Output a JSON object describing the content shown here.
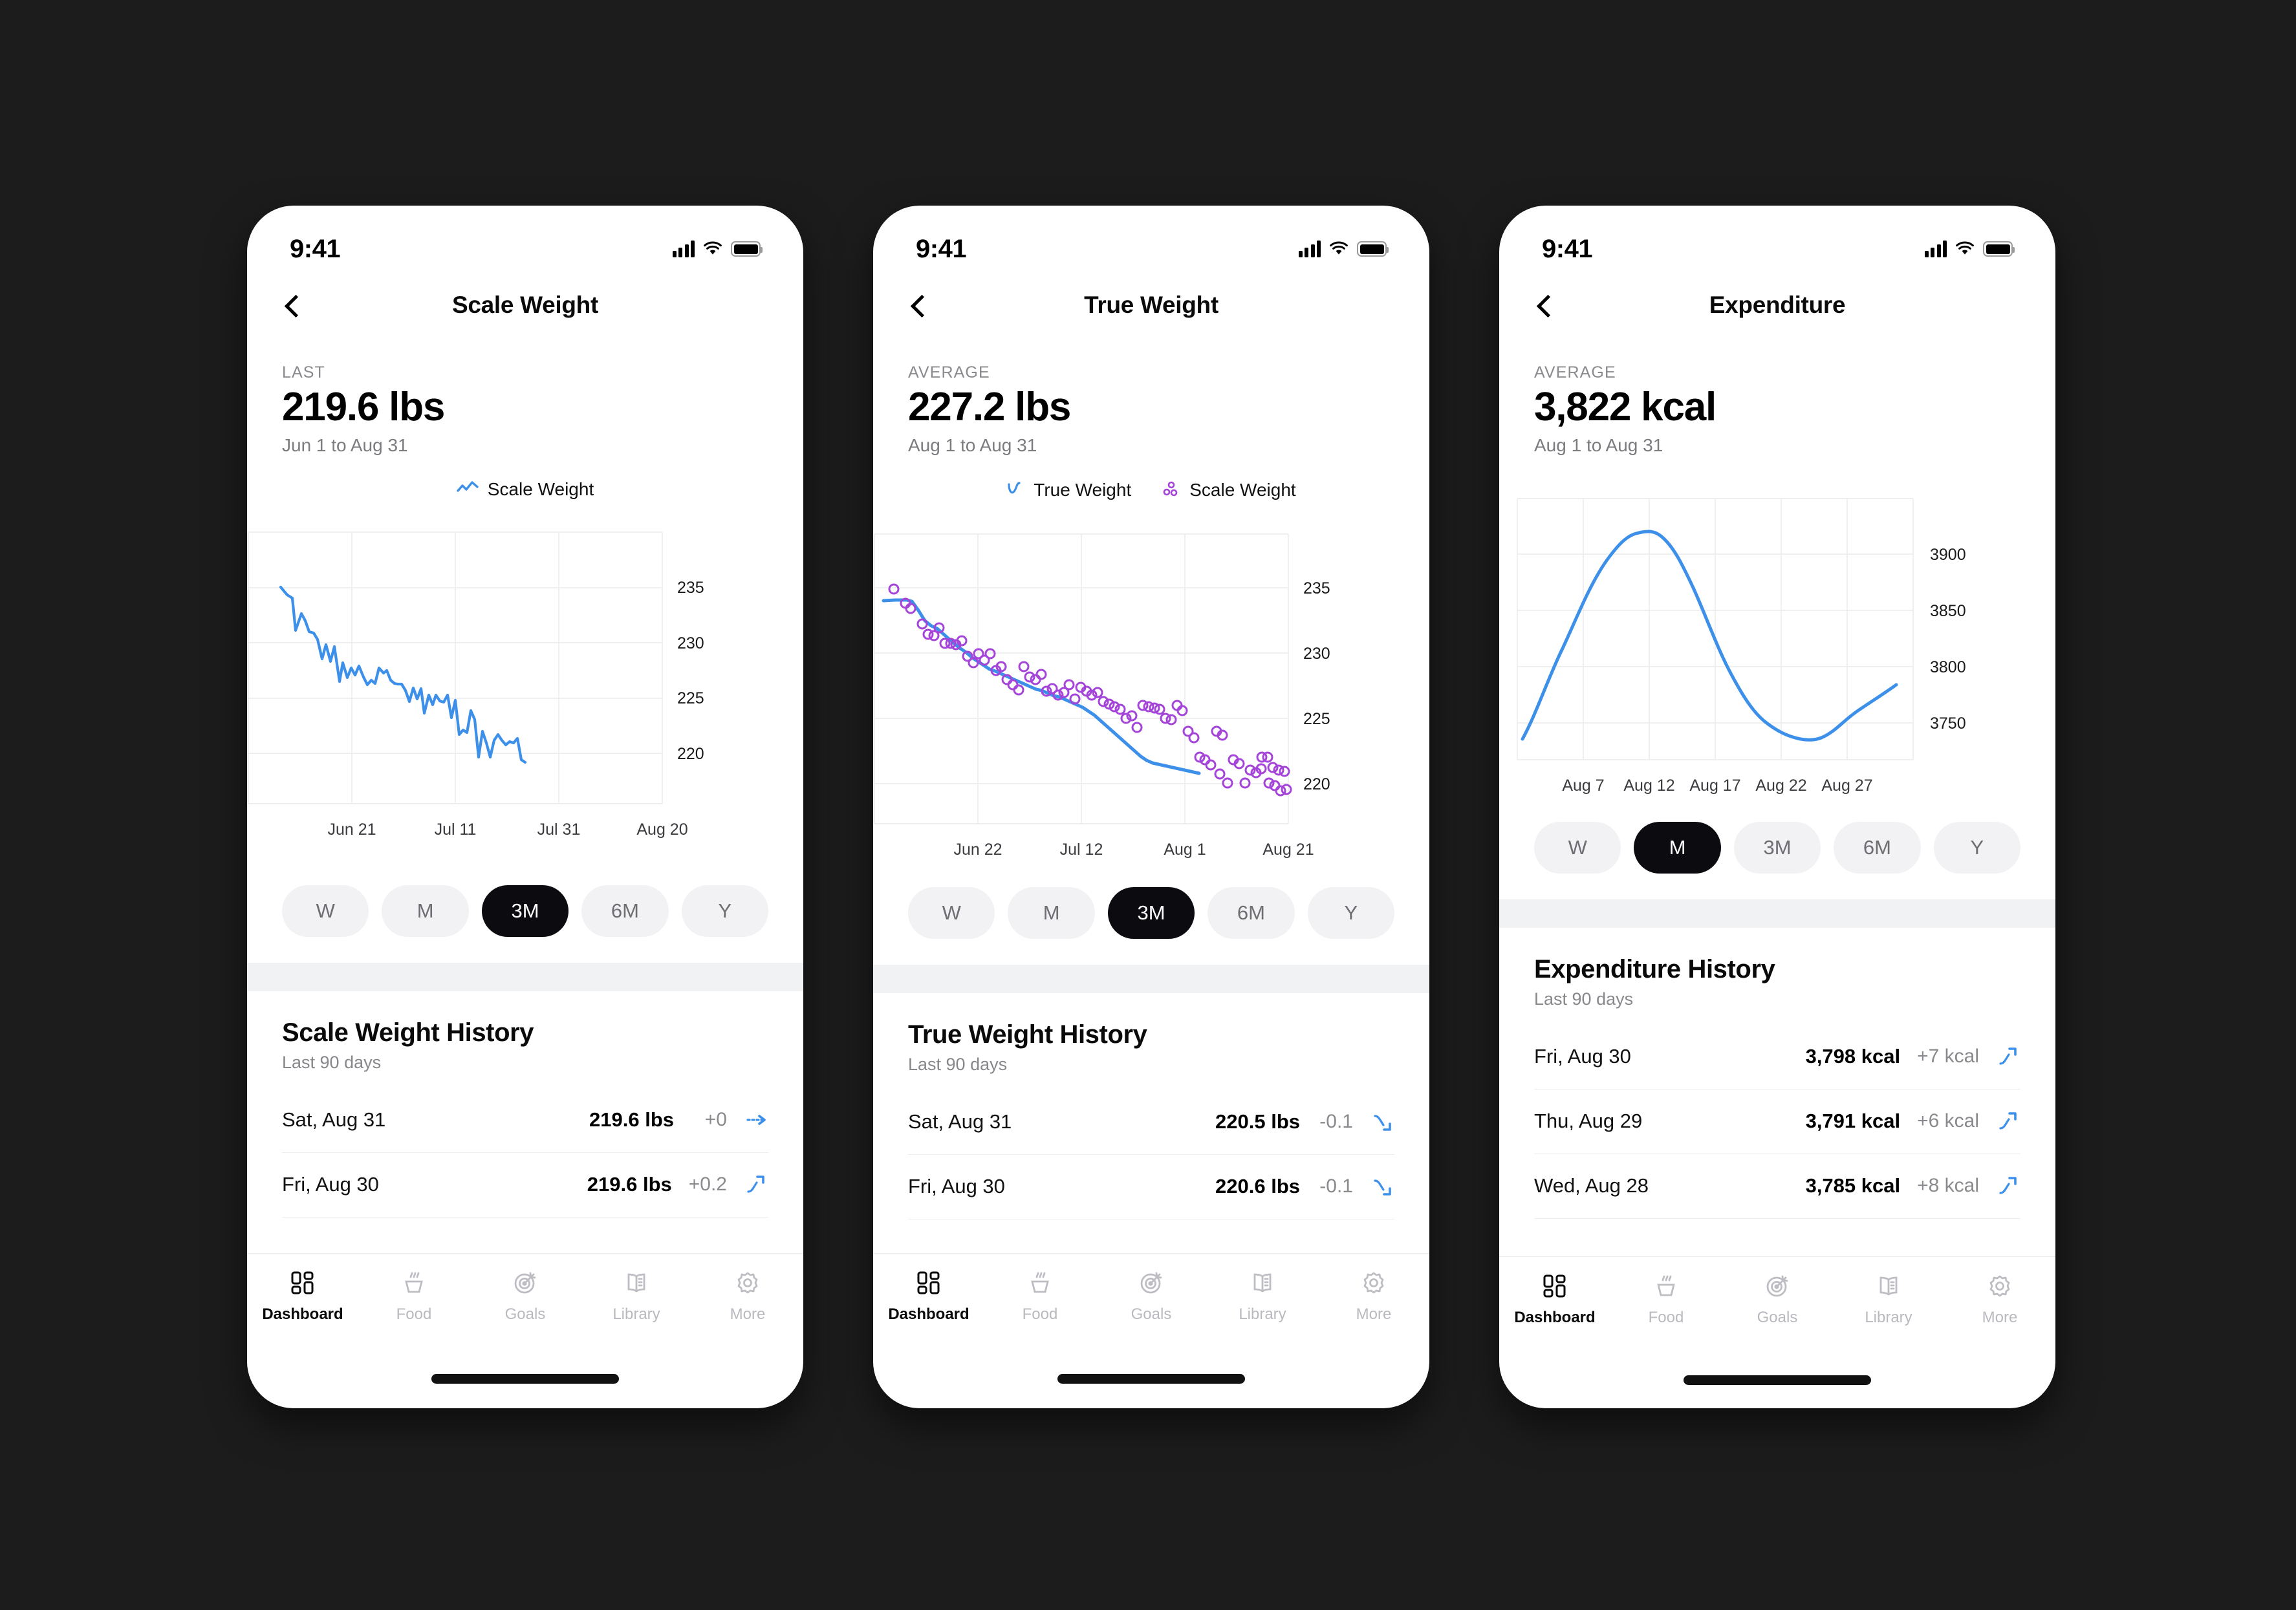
{
  "colors": {
    "accent_blue": "#3d90ea",
    "scatter_purple": "#a444d8",
    "active_pill": "#0b0b10",
    "pill_bg": "#f2f2f4",
    "canvas_bg": "#1c1c1c",
    "muted_text": "#8a8a8e"
  },
  "status_bar": {
    "time": "9:41"
  },
  "tabs": [
    {
      "label": "Dashboard",
      "icon": "dashboard-icon",
      "active": true
    },
    {
      "label": "Food",
      "icon": "food-cup-icon",
      "active": false
    },
    {
      "label": "Goals",
      "icon": "target-icon",
      "active": false
    },
    {
      "label": "Library",
      "icon": "book-icon",
      "active": false
    },
    {
      "label": "More",
      "icon": "gear-icon",
      "active": false
    }
  ],
  "range_options": [
    "W",
    "M",
    "3M",
    "6M",
    "Y"
  ],
  "screens": [
    {
      "id": "scale-weight",
      "nav_title": "Scale Weight",
      "summary_label": "LAST",
      "summary_value": "219.6 lbs",
      "summary_range": "Jun 1 to Aug 31",
      "legend": [
        {
          "label": "Scale Weight",
          "icon": "line-chart-icon",
          "color": "#3d90ea"
        }
      ],
      "selected_range": "3M",
      "history_title": "Scale Weight History",
      "history_sub": "Last 90 days",
      "history_rows": [
        {
          "date": "Sat, Aug 31",
          "value": "219.6 lbs",
          "delta": "+0",
          "trend": "flat"
        },
        {
          "date": "Fri, Aug 30",
          "value": "219.6 lbs",
          "delta": "+0.2",
          "trend": "up"
        }
      ]
    },
    {
      "id": "true-weight",
      "nav_title": "True Weight",
      "summary_label": "AVERAGE",
      "summary_value": "227.2 lbs",
      "summary_range": "Aug 1 to Aug 31",
      "legend": [
        {
          "label": "True Weight",
          "icon": "wave-line-icon",
          "color": "#3d90ea"
        },
        {
          "label": "Scale Weight",
          "icon": "scatter-dots-icon",
          "color": "#a444d8"
        }
      ],
      "selected_range": "3M",
      "history_title": "True Weight History",
      "history_sub": "Last 90 days",
      "history_rows": [
        {
          "date": "Sat, Aug 31",
          "value": "220.5 lbs",
          "delta": "-0.1",
          "trend": "down"
        },
        {
          "date": "Fri, Aug 30",
          "value": "220.6 lbs",
          "delta": "-0.1",
          "trend": "down"
        }
      ]
    },
    {
      "id": "expenditure",
      "nav_title": "Expenditure",
      "summary_label": "AVERAGE",
      "summary_value": "3,822 kcal",
      "summary_range": "Aug 1 to Aug 31",
      "legend": [],
      "selected_range": "M",
      "history_title": "Expenditure History",
      "history_sub": "Last 90 days",
      "history_rows": [
        {
          "date": "Fri, Aug 30",
          "value": "3,798 kcal",
          "delta": "+7 kcal",
          "trend": "up"
        },
        {
          "date": "Thu, Aug 29",
          "value": "3,791 kcal",
          "delta": "+6 kcal",
          "trend": "up"
        },
        {
          "date": "Wed, Aug 28",
          "value": "3,785 kcal",
          "delta": "+8 kcal",
          "trend": "up"
        }
      ]
    }
  ],
  "chart_data": [
    {
      "id": "scale-weight-chart",
      "type": "line",
      "title": "Scale Weight",
      "xlabel": "",
      "ylabel": "lbs",
      "ylim": [
        217,
        237
      ],
      "yticks": [
        220,
        225,
        230,
        235
      ],
      "xticks": [
        "Jun 21",
        "Jul 11",
        "Jul 31",
        "Aug 20"
      ],
      "grid": true,
      "legend_position": "top-center",
      "series": [
        {
          "name": "Scale Weight",
          "color": "#3d90ea",
          "values": [
            234.9,
            234.2,
            233.9,
            231.6,
            232.9,
            232.3,
            231.3,
            231.2,
            230.6,
            229.1,
            230.1,
            228.6,
            229.9,
            226.8,
            228.4,
            227.1,
            228.0,
            227.4,
            228.2,
            227.2,
            226.5,
            226.9,
            226.6,
            228.0,
            227.4,
            227.8,
            226.9,
            226.6,
            226.5,
            226.5,
            225.9,
            224.9,
            226.2,
            225.2,
            226.1,
            223.9,
            225.6,
            224.7,
            225.6,
            225.0,
            224.9,
            225.5,
            223.5,
            225.1,
            222.0,
            222.4,
            222.2,
            224.2,
            223.4,
            220.0,
            222.3,
            221.2,
            220.0,
            221.5,
            222.0,
            221.5,
            221.1,
            221.4,
            221.3,
            221.7,
            219.8,
            219.6
          ]
        }
      ]
    },
    {
      "id": "true-weight-chart",
      "type": "scatter+line",
      "title": "True Weight",
      "xlabel": "",
      "ylabel": "lbs",
      "ylim": [
        217,
        237
      ],
      "yticks": [
        220,
        225,
        230,
        235
      ],
      "xticks": [
        "Jun 22",
        "Jul 12",
        "Aug 1",
        "Aug 21"
      ],
      "grid": true,
      "legend_position": "top-center",
      "series": [
        {
          "name": "True Weight",
          "type": "line",
          "color": "#3d90ea",
          "values": [
            234.0,
            234.0,
            234.0,
            233.9,
            233.2,
            232.4,
            232.0,
            231.8,
            231.4,
            231.0,
            230.6,
            230.2,
            229.9,
            229.5,
            229.2,
            228.9,
            228.6,
            228.4,
            228.2,
            228.0,
            227.8,
            227.6,
            227.4,
            227.2,
            227.0,
            226.9,
            226.7,
            226.5,
            226.4,
            226.2,
            226.0,
            225.8,
            225.6,
            225.3,
            225.0,
            224.6,
            224.2,
            223.8,
            223.4,
            223.0,
            222.6,
            222.2,
            221.8,
            221.5,
            221.3,
            221.2,
            221.1,
            221.0,
            220.9,
            220.8,
            220.7,
            220.6,
            220.5
          ]
        },
        {
          "name": "Scale Weight",
          "type": "scatter",
          "color": "#a444d8",
          "points": [
            [
              2,
              235.0
            ],
            [
              4,
              233.9
            ],
            [
              5,
              233.5
            ],
            [
              7,
              232.3
            ],
            [
              8,
              231.5
            ],
            [
              9,
              231.4
            ],
            [
              10,
              232.0
            ],
            [
              11,
              230.8
            ],
            [
              12,
              230.8
            ],
            [
              13,
              230.7
            ],
            [
              14,
              231.0
            ],
            [
              15,
              229.8
            ],
            [
              16,
              229.3
            ],
            [
              17,
              230.0
            ],
            [
              18,
              229.5
            ],
            [
              19,
              230.0
            ],
            [
              20,
              228.7
            ],
            [
              21,
              229.0
            ],
            [
              22,
              228.0
            ],
            [
              23,
              227.6
            ],
            [
              24,
              227.2
            ],
            [
              25,
              229.0
            ],
            [
              26,
              228.2
            ],
            [
              27,
              228.0
            ],
            [
              28,
              228.4
            ],
            [
              29,
              227.1
            ],
            [
              30,
              227.3
            ],
            [
              31,
              226.8
            ],
            [
              32,
              227.0
            ],
            [
              33,
              227.6
            ],
            [
              34,
              226.5
            ],
            [
              35,
              227.4
            ],
            [
              36,
              227.1
            ],
            [
              37,
              226.8
            ],
            [
              38,
              227.0
            ],
            [
              39,
              226.3
            ],
            [
              40,
              226.1
            ],
            [
              41,
              225.9
            ],
            [
              42,
              225.7
            ],
            [
              43,
              225.0
            ],
            [
              44,
              225.2
            ],
            [
              45,
              224.3
            ],
            [
              46,
              226.0
            ],
            [
              47,
              225.9
            ],
            [
              48,
              225.8
            ],
            [
              49,
              225.7
            ],
            [
              50,
              225.0
            ],
            [
              51,
              224.9
            ],
            [
              52,
              226.0
            ],
            [
              53,
              225.6
            ],
            [
              54,
              224.0
            ],
            [
              55,
              223.5
            ],
            [
              56,
              222.0
            ],
            [
              57,
              221.8
            ],
            [
              58,
              221.4
            ],
            [
              59,
              224.0
            ],
            [
              60,
              223.7
            ],
            [
              61,
              220.0
            ],
            [
              62,
              221.8
            ],
            [
              63,
              221.5
            ],
            [
              64,
              220.0
            ],
            [
              65,
              221.0
            ],
            [
              66,
              220.8
            ],
            [
              67,
              222.0
            ],
            [
              68,
              222.0
            ],
            [
              69,
              221.2
            ],
            [
              70,
              221.0
            ],
            [
              71,
              220.9
            ],
            [
              72,
              220.6
            ],
            [
              73,
              221.0
            ],
            [
              74,
              220.0
            ],
            [
              75,
              219.8
            ],
            [
              76,
              219.4
            ],
            [
              77,
              219.5
            ]
          ]
        }
      ]
    },
    {
      "id": "expenditure-chart",
      "type": "line",
      "title": "Expenditure",
      "xlabel": "",
      "ylabel": "kcal",
      "ylim": [
        3725,
        3930
      ],
      "yticks": [
        3750,
        3800,
        3850,
        3900
      ],
      "xticks": [
        "Aug 7",
        "Aug 12",
        "Aug 17",
        "Aug 22",
        "Aug 27"
      ],
      "grid": true,
      "series": [
        {
          "name": "Expenditure",
          "color": "#3d90ea",
          "values": [
            3736,
            3772,
            3812,
            3848,
            3875,
            3895,
            3908,
            3915,
            3917,
            3916,
            3910,
            3898,
            3882,
            3864,
            3845,
            3826,
            3808,
            3793,
            3783,
            3775,
            3768,
            3763,
            3760,
            3760,
            3762,
            3766,
            3771,
            3776,
            3784,
            3798
          ]
        }
      ]
    }
  ]
}
